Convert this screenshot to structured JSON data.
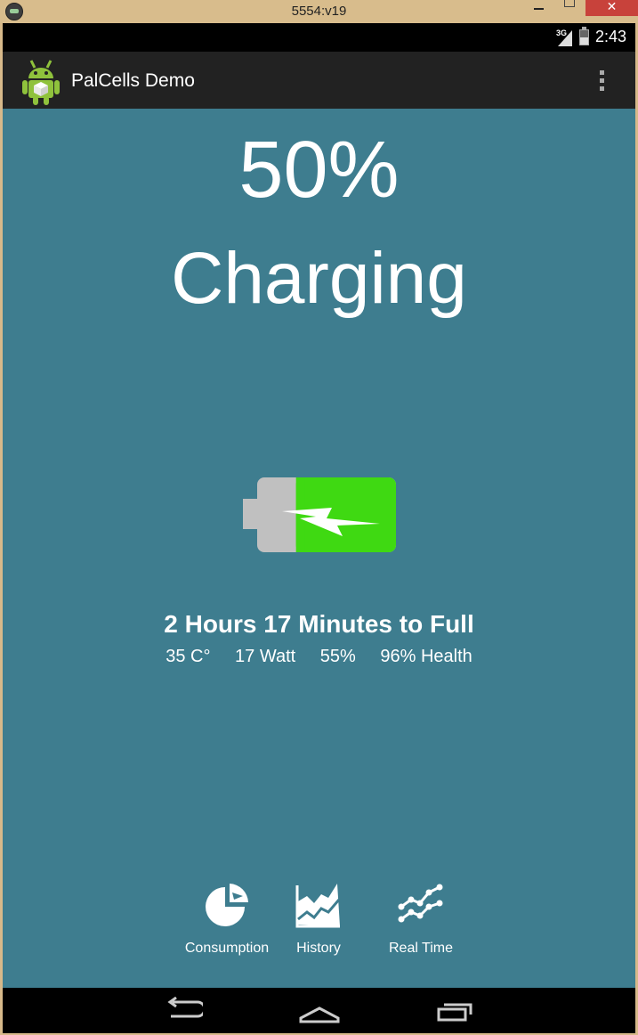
{
  "window": {
    "title": "5554:v19"
  },
  "statusbar": {
    "network": "3G",
    "time": "2:43"
  },
  "actionbar": {
    "title": "PalCells Demo"
  },
  "battery": {
    "percent_text": "50%",
    "state": "Charging",
    "charge_fraction": 0.5,
    "fill_color": "#3fd912",
    "empty_color": "#c0c0c0",
    "eta": "2 Hours 17 Minutes to Full",
    "temperature": "35 C°",
    "power": "17 Watt",
    "level": "55%",
    "health": "96% Health"
  },
  "tabs": [
    {
      "label": "Consumption",
      "icon": "pie-chart-icon"
    },
    {
      "label": "History",
      "icon": "area-chart-icon"
    },
    {
      "label": "Real Time",
      "icon": "line-chart-icon"
    }
  ],
  "colors": {
    "background": "#3e7d8f",
    "actionbar": "#222222"
  }
}
